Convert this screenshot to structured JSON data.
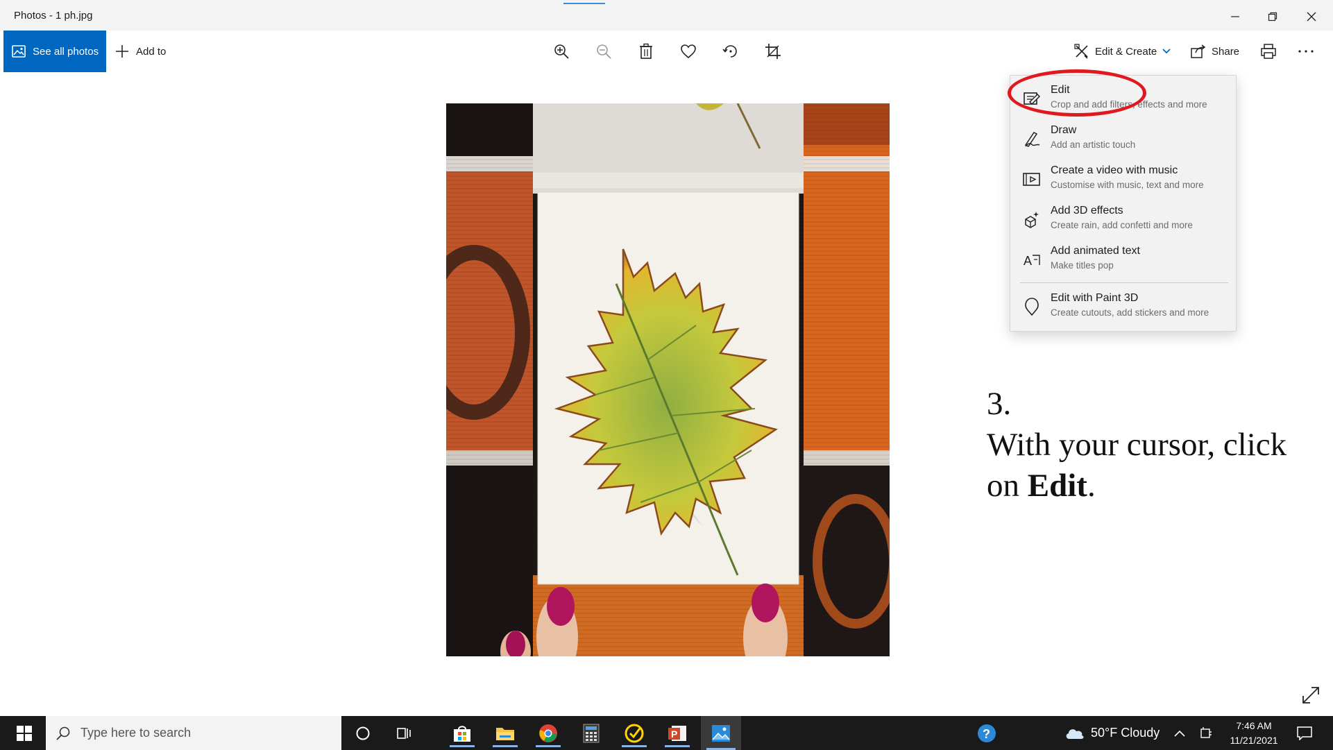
{
  "window": {
    "title": "Photos - 1 ph.jpg"
  },
  "toolbar": {
    "see_all_photos": "See all photos",
    "add_to": "Add to",
    "edit_create": "Edit & Create",
    "share": "Share"
  },
  "menu": {
    "items": [
      {
        "title": "Edit",
        "subtitle": "Crop and add filters, effects and more",
        "icon": "edit-icon"
      },
      {
        "title": "Draw",
        "subtitle": "Add an artistic touch",
        "icon": "draw-icon"
      },
      {
        "title": "Create a video with music",
        "subtitle": "Customise with music, text and more",
        "icon": "video-icon"
      },
      {
        "title": "Add 3D effects",
        "subtitle": "Create rain, add confetti and more",
        "icon": "3d-effects-icon"
      },
      {
        "title": "Add animated text",
        "subtitle": "Make titles pop",
        "icon": "animated-text-icon"
      },
      {
        "title": "Edit with Paint 3D",
        "subtitle": "Create cutouts, add stickers and more",
        "icon": "paint3d-icon"
      }
    ]
  },
  "annotation": {
    "step": "3.",
    "line1": "With your cursor, click",
    "line2_prefix": "on ",
    "line2_bold": "Edit",
    "line2_suffix": "."
  },
  "taskbar": {
    "search_placeholder": "Type here to search",
    "weather": "50°F  Cloudy",
    "time": "7:46 AM",
    "date": "11/21/2021"
  },
  "colors": {
    "accent": "#0067c0",
    "highlight_ellipse": "#e0191e",
    "taskbar": "#1a1a1a"
  }
}
